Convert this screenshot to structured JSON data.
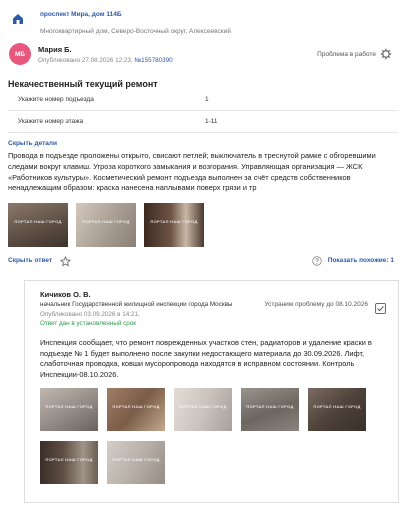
{
  "header": {
    "address": "проспект Мира, дом 114Б",
    "subtitle": "Многоквартирный дом, Северо-Восточный округ, Алексеевский"
  },
  "author": {
    "initials": "МБ",
    "name": "Мария Б.",
    "published_prefix": "Опубликовано 27.08.2026 12:23, ",
    "number": "№155780390",
    "status": "Проблема в работе"
  },
  "issue": {
    "title": "Некачественный текущий ремонт",
    "fields": [
      {
        "label": "Укажите номер подъезда",
        "value": "1"
      },
      {
        "label": "Укажите номер этажа",
        "value": "1-11"
      }
    ],
    "hide_details": "Скрыть детали",
    "description": "Провода в подъезде проложены открыто, свисают петлей; выключатель в треснутой рамке с обгоревшими следами вокруг клавиш. Угроза короткого замыкания и возгорания. Управляющая организация — ЖСК «Работников культуры». Косметический ремонт подъезда выполнен за счёт средств собственников ненадлежащим образом: краска нанесена наплывами поверх грязи и тр",
    "photos": [
      {
        "watermark": "ПОРТАЛ НАШ ГОРОД",
        "color": "#6b5e54"
      },
      {
        "watermark": "ПОРТАЛ НАШ ГОРОД",
        "color": "#b8ada2"
      },
      {
        "watermark": "ПОРТАЛ НАШ ГОРОД",
        "color": "#4e3a30"
      }
    ]
  },
  "actions": {
    "hide_reply": "Скрыть ответ",
    "star_icon": "star-icon",
    "similar": "Показать похожие: 1"
  },
  "reply": {
    "name": "Кичиков О. В.",
    "role": "начальник Государственной жилищной инспекции города Москвы",
    "published": "Опубликовано 03.09.2026 в 14:21,",
    "on_time": "Ответ дан в установленный срок",
    "fix_note": "Устраним проблему до 08.10.2026",
    "text": "Инспекция сообщает, что ремонт поврежденных участков стен, радиаторов и удаление краски в подъезде № 1 будет выполнено после закупки недостающего материала до 30.09.2026. Лифт, слаботочная проводка, ковши мусоропровода находятся в исправном состоянии. Контроль Инспекции-08.10.2026.",
    "photos": [
      {
        "watermark": "ПОРТАЛ НАШ ГОРОД",
        "color": "#a29a92"
      },
      {
        "watermark": "ПОРТАЛ НАШ ГОРОД",
        "color": "#8a6e5a"
      },
      {
        "watermark": "ПОРТАЛ НАШ ГОРОД",
        "color": "#cfc9c4"
      },
      {
        "watermark": "ПОРТАЛ НАШ ГОРОД",
        "color": "#7a7470"
      },
      {
        "watermark": "ПОРТАЛ НАШ ГОРОД",
        "color": "#5a4e46"
      },
      {
        "watermark": "ПОРТАЛ НАШ ГОРОД",
        "color": "#4a3e38"
      },
      {
        "watermark": "ПОРТАЛ НАШ ГОРОД",
        "color": "#bdb6ae"
      }
    ]
  },
  "colors": {
    "accent": "#2c5aa8",
    "avatar": "#e8577e",
    "ok_green": "#2e9a4a"
  }
}
